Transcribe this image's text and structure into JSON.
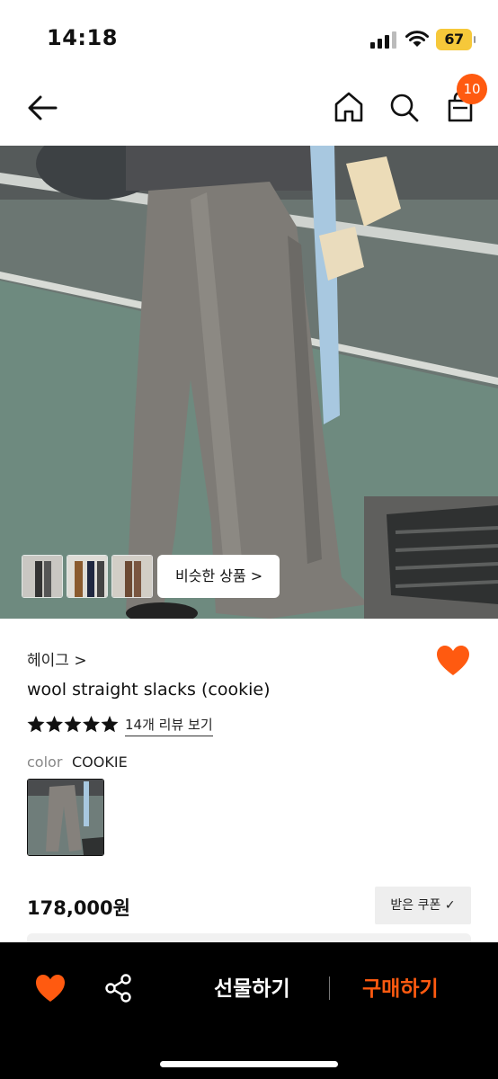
{
  "status_bar": {
    "time": "14:18",
    "battery": "67"
  },
  "header": {
    "back_icon": "arrow-left-icon",
    "home_icon": "home-icon",
    "search_icon": "search-icon",
    "cart_icon": "shopping-bag-icon",
    "cart_count": "10"
  },
  "hero": {
    "similar_products_label": "비슷한 상품 >",
    "thumbnail_count": 3
  },
  "product": {
    "brand": "헤이그 >",
    "name": "wool straight slacks (cookie)",
    "rating_stars": 5,
    "review_link": "14개 리뷰 보기",
    "color_label": "color",
    "color_value": "COOKIE",
    "price": "178,000원",
    "coupon_label": "받은 쿠폰 ✓"
  },
  "bottom_bar": {
    "gift_label": "선물하기",
    "buy_label": "구매하기"
  },
  "colors": {
    "accent": "#ff5a10",
    "bar_background": "#000000",
    "text": "#111111"
  }
}
